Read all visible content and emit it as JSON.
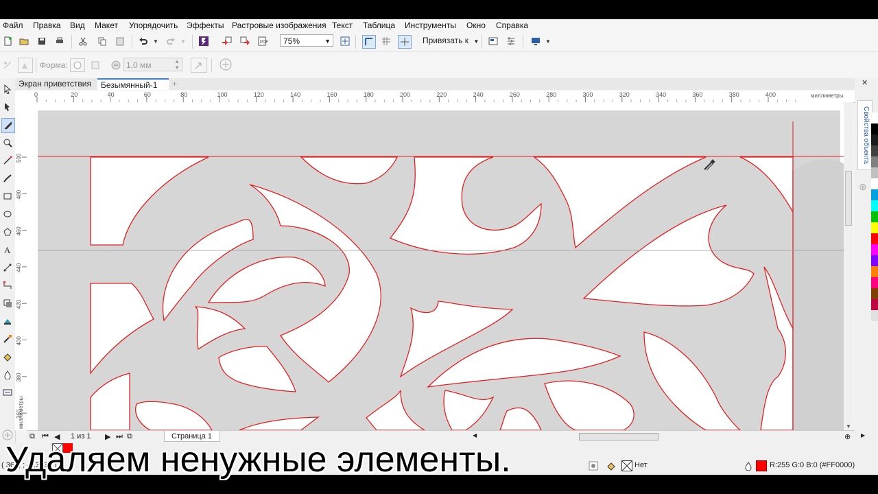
{
  "menu": [
    "Файл",
    "Правка",
    "Вид",
    "Макет",
    "Упорядочить",
    "Эффекты",
    "Растровые изображения",
    "Текст",
    "Таблица",
    "Инструменты",
    "Окно",
    "Справка"
  ],
  "toolbar": {
    "zoom_value": "75%",
    "snap_label": "Привязать к",
    "shape_label": "Форма:",
    "outline_width": "1,0 мм"
  },
  "tabs": [
    "Экран приветствия",
    "Безымянный-1"
  ],
  "ruler": {
    "h_ticks": [
      "0",
      "20",
      "40",
      "60",
      "80",
      "100",
      "120",
      "140",
      "160",
      "180",
      "200",
      "220",
      "240",
      "260",
      "280",
      "300",
      "320",
      "340",
      "360",
      "380",
      "400"
    ],
    "h_unit": "миллиметры",
    "v_ticks": [
      "500",
      "480",
      "460",
      "440",
      "420",
      "400",
      "380",
      "360"
    ],
    "v_unit": "миллиметры"
  },
  "docker_tab": "Свойства объекта",
  "page_nav": {
    "counter": "1 из 1",
    "page_tab": "Страница 1"
  },
  "status": {
    "coords": "( 361,   ; 4 ,3  ,35  )",
    "fill_none": "Нет",
    "outline_color": "R:255 G:0 B:0 (#FF0000)"
  },
  "caption": "Удаляем ненужные элементы.",
  "colors": {
    "outline_red": "#e02020",
    "board_gray": "#d6d6d6",
    "accent": "#3c7fd6"
  },
  "palette": [
    "#ffffff",
    "#000000",
    "#1a1a1a",
    "#404040",
    "#808080",
    "#c0c0c0",
    "#ffffff",
    "#00a0e0",
    "#00ffff",
    "#00c000",
    "#ffff00",
    "#ff0000",
    "#ff00ff",
    "#8000ff",
    "#ff8000",
    "#ff0080",
    "#804000",
    "#c00040",
    "#e0e0e0",
    "#f0f0f0"
  ]
}
